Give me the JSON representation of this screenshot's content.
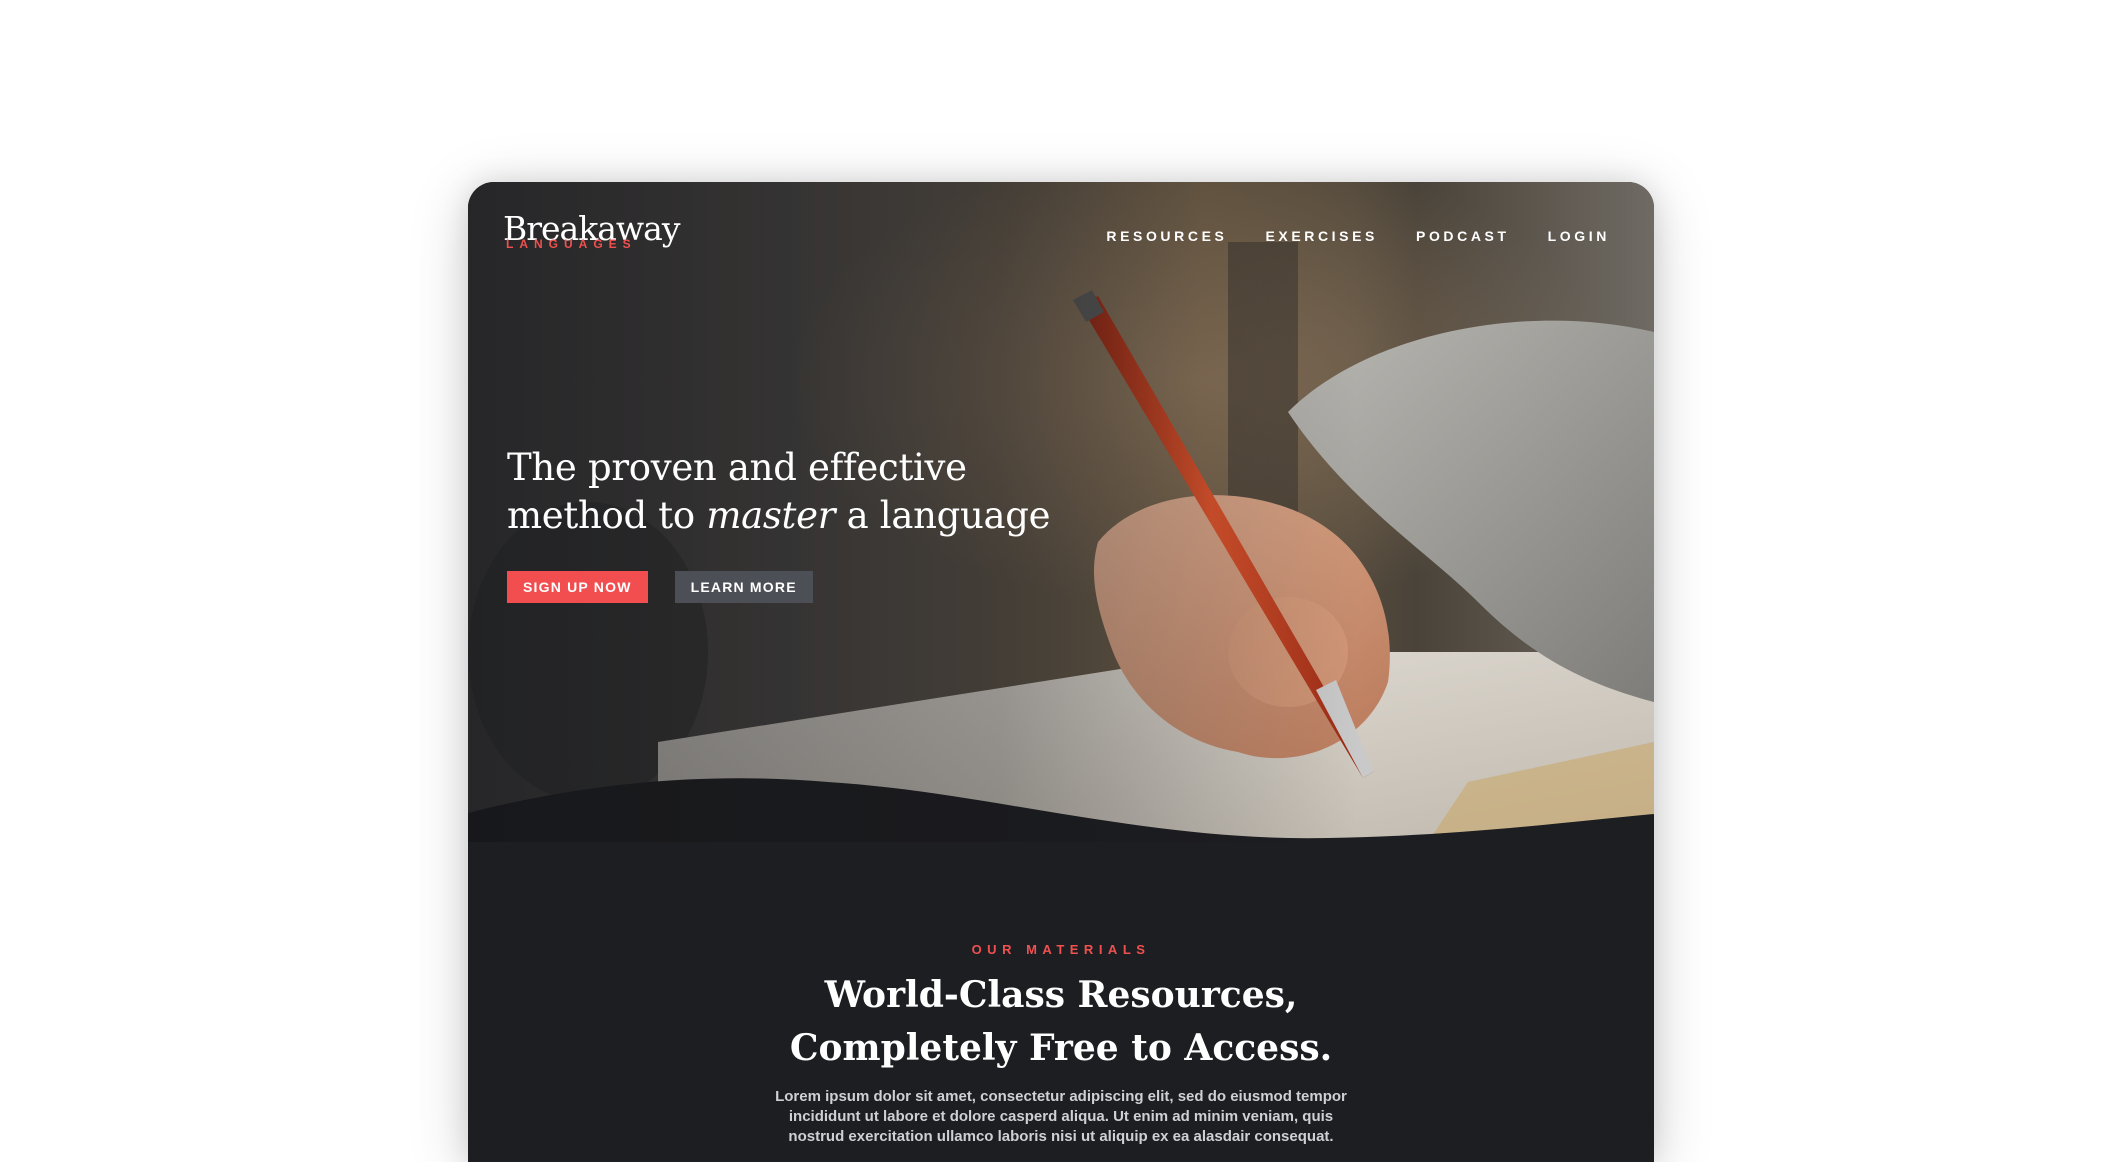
{
  "brand": {
    "name": "Breakaway",
    "tagline": "LANGUAGES",
    "accent_color": "#f0514f"
  },
  "nav": {
    "items": [
      {
        "label": "RESOURCES"
      },
      {
        "label": "EXERCISES"
      },
      {
        "label": "PODCAST"
      },
      {
        "label": "LOGIN"
      }
    ]
  },
  "hero": {
    "headline_line1": "The proven and effective",
    "headline_line2_before": "method to ",
    "headline_line2_emphasis": "master",
    "headline_line2_after": " a language",
    "primary_cta": "SIGN UP NOW",
    "secondary_cta": "LEARN MORE",
    "image": "hand-writing-with-red-pen-photo"
  },
  "materials": {
    "eyebrow": "OUR MATERIALS",
    "title_line1": "World-Class Resources,",
    "title_line2": "Completely Free to Access.",
    "body": "Lorem ipsum dolor sit amet, consectetur adipiscing elit, sed do eiusmod tempor incididunt ut labore et dolore casperd aliqua. Ut enim ad minim veniam, quis nostrud exercitation ullamco laboris nisi ut aliquip ex ea alasdair consequat."
  },
  "colors": {
    "primary_button": "#f24e50",
    "secondary_button": "#4d4f56",
    "section_background": "#1d1e22"
  }
}
